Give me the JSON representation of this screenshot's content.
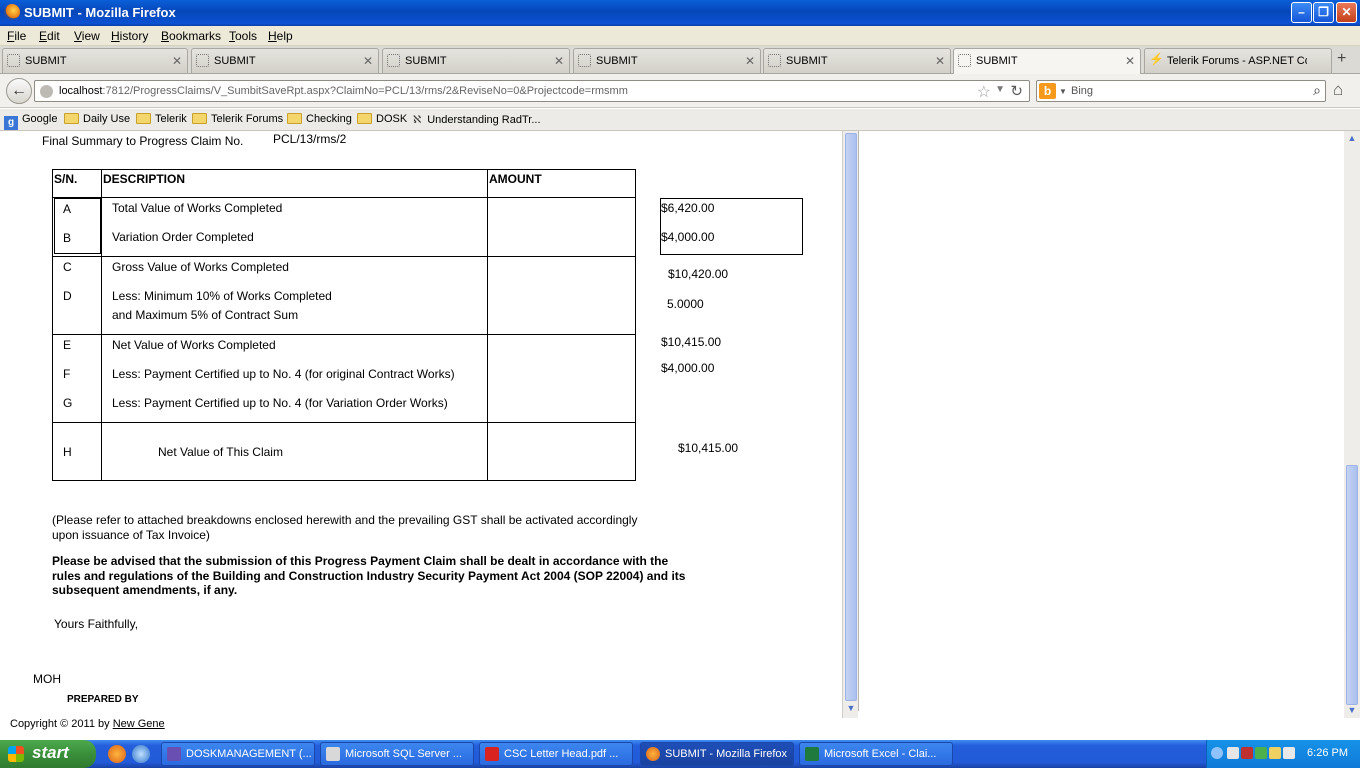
{
  "window": {
    "title": "SUBMIT - Mozilla Firefox"
  },
  "menu": [
    "File",
    "Edit",
    "View",
    "History",
    "Bookmarks",
    "Tools",
    "Help"
  ],
  "tabs": [
    {
      "label": "SUBMIT"
    },
    {
      "label": "SUBMIT"
    },
    {
      "label": "SUBMIT"
    },
    {
      "label": "SUBMIT"
    },
    {
      "label": "SUBMIT"
    },
    {
      "label": "SUBMIT"
    },
    {
      "label": "Telerik Forums - ASP.NET Co..."
    }
  ],
  "nav": {
    "url_host": "localhost",
    "url_rest": ":7812/ProgressClaims/V_SumbitSaveRpt.aspx?ClaimNo=PCL/13/rms/2&ReviseNo=0&Projectcode=rmsmm",
    "search_placeholder": "Bing"
  },
  "bookmarks": [
    "Google",
    "Daily Use",
    "Telerik",
    "Telerik Forums",
    "Checking",
    "DOSK",
    "Understanding RadTr..."
  ],
  "report": {
    "heading": "Final Summary to Progress Claim No.",
    "claim_no": "PCL/13/rms/2",
    "col_sn": "S/N.",
    "col_desc": "DESCRIPTION",
    "col_amount": "AMOUNT",
    "rows": [
      {
        "sn": "A",
        "desc": "Total Value of Works Completed",
        "value": "$6,420.00"
      },
      {
        "sn": "B",
        "desc": "Variation Order Completed",
        "value": "$4,000.00"
      },
      {
        "sn": "C",
        "desc": "Gross Value of Works Completed",
        "value": "$10,420.00"
      },
      {
        "sn": "D",
        "desc": "Less: Minimum 10% of Works Completed",
        "desc2": "and Maximum 5% of Contract Sum",
        "value": "5.0000"
      },
      {
        "sn": "E",
        "desc": "Net Value of Works Completed",
        "value": "$10,415.00"
      },
      {
        "sn": "F",
        "desc": "Less: Payment Certified up to No. 4 (for original Contract Works)",
        "value": "$4,000.00"
      },
      {
        "sn": "G",
        "desc": "Less: Payment Certified up to No. 4 (for Variation Order Works)"
      },
      {
        "sn": "H",
        "desc": "Net Value of This Claim",
        "value": "$10,415.00"
      }
    ],
    "note1": "(Please refer to attached breakdowns enclosed herewith and the prevailing GST shall be activated accordingly",
    "note2": "upon issuance of Tax Invoice)",
    "advice1": "Please be advised that the submission of this Progress Payment Claim shall be dealt in accordance with the",
    "advice2": "rules and regulations of the Building and Construction Industry Security Payment Act 2004 (SOP 22004) and its",
    "advice3": "subsequent amendments, if any.",
    "closing": "Yours Faithfully,",
    "signer": "MOH",
    "prepared_by": "PREPARED BY"
  },
  "footer": {
    "copyright": "Copyright © 2011 by",
    "company": "New Gene"
  },
  "taskbar": {
    "start": "start",
    "tasks": [
      {
        "label": "DOSKMANAGEMENT (..."
      },
      {
        "label": "Microsoft SQL Server ..."
      },
      {
        "label": "CSC Letter Head.pdf ..."
      },
      {
        "label": "SUBMIT - Mozilla Firefox"
      },
      {
        "label": "Microsoft Excel - Clai..."
      }
    ],
    "clock": "6:26 PM"
  }
}
